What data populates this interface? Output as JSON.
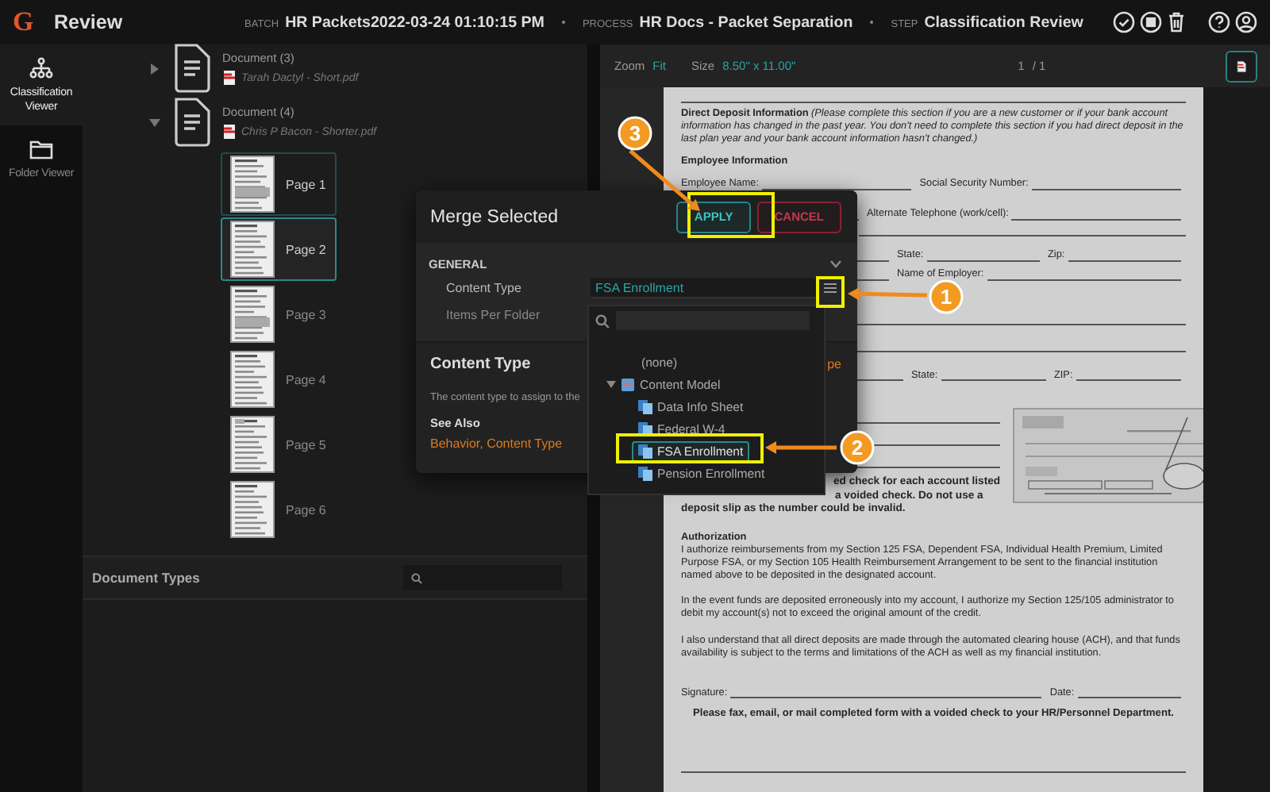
{
  "app": {
    "logo": "G",
    "title": "Review"
  },
  "header": {
    "fields": [
      {
        "label": "BATCH",
        "value": "HR Packets2022-03-24 01:10:15 PM"
      },
      {
        "label": "PROCESS",
        "value": "HR Docs - Packet Separation"
      },
      {
        "label": "STEP",
        "value": "Classification Review"
      }
    ]
  },
  "rail": {
    "items": [
      {
        "label": "Classification Viewer",
        "kind": "tree",
        "selected": true
      },
      {
        "label": "Folder Viewer",
        "kind": "folder",
        "selected": false
      }
    ]
  },
  "tree": {
    "documents": [
      {
        "name": "Document (3)",
        "file": "Tarah Dactyl - Short.pdf",
        "expanded": false
      },
      {
        "name": "Document (4)",
        "file": "Chris P Bacon - Shorter.pdf",
        "expanded": true,
        "pages": [
          {
            "label": "Page 1",
            "selected": true,
            "current": false
          },
          {
            "label": "Page 2",
            "selected": true,
            "current": true
          },
          {
            "label": "Page 3",
            "selected": false,
            "current": false
          },
          {
            "label": "Page 4",
            "selected": false,
            "current": false
          },
          {
            "label": "Page 5",
            "selected": false,
            "current": false
          },
          {
            "label": "Page 6",
            "selected": false,
            "current": false
          }
        ]
      }
    ]
  },
  "document_types": {
    "title": "Document Types"
  },
  "viewer": {
    "zoom_label": "Zoom",
    "zoom": "Fit",
    "size_label": "Size",
    "size": "8.50\" x 11.00\"",
    "page": "1",
    "page_total": "/ 1"
  },
  "document": {
    "intro": "**Direct Deposit Information** *(Please complete this section if you are a new customer or if your bank account information has changed in the past year. You don't need to complete this section if you had direct deposit in the last plan year and your bank account information hasn't changed.)*",
    "section": "Employee Information",
    "rows": [
      {
        "lead_line": false,
        "fields": [
          "Employee Name:",
          "Social Security Number:"
        ]
      },
      {
        "lead_line": true,
        "fields": [
          "Alternate Telephone (work/cell):"
        ]
      },
      {
        "lead_line": true,
        "fields": [
          "State:",
          "Zip:"
        ]
      },
      {
        "lead_line": true,
        "fields": [
          "Name of Employer:"
        ]
      },
      {
        "lead_line": true,
        "fields": [
          "State:",
          "ZIP:"
        ]
      }
    ],
    "note_lines": [
      "ed check for each account listed",
      "a voided check. Do not use a",
      "deposit slip as the number could be invalid."
    ],
    "authorization": {
      "title": "Authorization",
      "paragraphs": [
        "I authorize reimbursements from my Section 125 FSA, Dependent FSA, Individual Health Premium, Limited Purpose FSA, or my Section 105 Health Reimbursement Arrangement to be sent to the financial institution named above to be deposited in the designated account.",
        "In the event funds are deposited erroneously into my account, I authorize my Section 125/105 administrator to debit my account(s) not to exceed the original amount of the credit.",
        "I also understand that all direct deposits are made through the automated clearing house (ACH), and that funds availability is subject to the terms and limitations of the ACH as well as my financial institution."
      ]
    },
    "signature_fields": [
      "Signature:",
      "Date:"
    ],
    "footer": "Please fax, email, or mail completed form with a voided check to your HR/Personnel Department."
  },
  "dialog": {
    "title": "Merge Selected",
    "buttons": [
      {
        "label": "APPLY",
        "kind": "primary"
      },
      {
        "label": "CANCEL",
        "kind": "danger"
      }
    ],
    "section": "GENERAL",
    "expanded": true,
    "fields": [
      {
        "label": "Content Type",
        "value": "FSA Enrollment"
      },
      {
        "label": "Items Per Folder"
      }
    ],
    "help": {
      "title": "Content Type",
      "cut_link": "pe",
      "description": "The content type to assign to the",
      "see_also": "See Also",
      "links": "Behavior, Content Type"
    }
  },
  "dropdown": {
    "options": [
      {
        "label": "(none)",
        "kind": "none"
      },
      {
        "label": "Content Model",
        "kind": "group",
        "expanded": true,
        "children": [
          {
            "label": "Data Info Sheet",
            "kind": "type",
            "selected": false
          },
          {
            "label": "Federal W-4",
            "kind": "type",
            "selected": false
          },
          {
            "label": "FSA Enrollment",
            "kind": "type",
            "selected": true
          },
          {
            "label": "Pension Enrollment",
            "kind": "type",
            "selected": false
          }
        ]
      }
    ]
  },
  "callouts": [
    {
      "number": "1"
    },
    {
      "number": "2"
    },
    {
      "number": "3"
    }
  ]
}
